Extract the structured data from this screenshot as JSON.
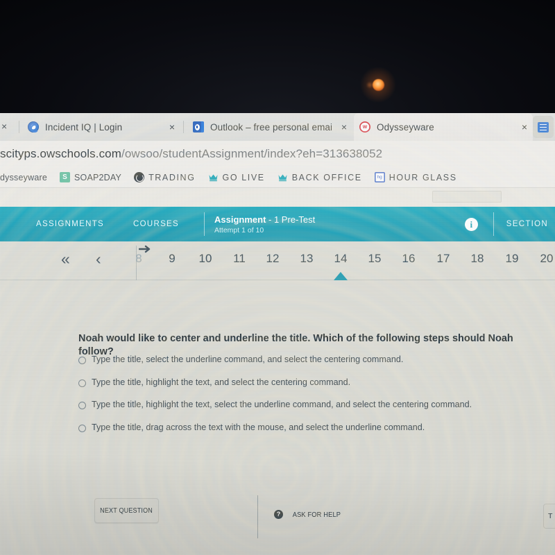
{
  "browser": {
    "tabs": [
      {
        "title": "Incident IQ | Login",
        "favicon": "incident-iq-icon",
        "close_label": "×",
        "active": false
      },
      {
        "title": "Outlook – free personal email",
        "favicon": "outlook-icon",
        "close_label": "×",
        "active": false
      },
      {
        "title": "Odysseyware",
        "favicon": "odysseyware-icon",
        "close_label": "×",
        "active": true
      }
    ],
    "leading_close_label": "×",
    "tab_list_icon": "tab-list-icon",
    "url": {
      "host": "scityps.owschools.com",
      "path": "/owsoo/studentAssignment/index?eh=313638052"
    },
    "bookmarks": [
      {
        "label": "dysseyware",
        "icon": ""
      },
      {
        "label": "SOAP2DAY",
        "icon": "soap2day-icon"
      },
      {
        "label": "TRADING",
        "icon": "globe-icon"
      },
      {
        "label": "GO LIVE",
        "icon": "crown-icon"
      },
      {
        "label": "BACK OFFICE",
        "icon": "crown-icon"
      },
      {
        "label": "HOUR GLASS",
        "icon": "hourglass-icon"
      }
    ]
  },
  "appbar": {
    "assignments_label": "ASSIGNMENTS",
    "courses_label": "COURSES",
    "assignment_name": "Assignment",
    "assignment_suffix": " - 1  Pre-Test",
    "attempt_text": "Attempt 1 of 10",
    "info_icon": "info-icon",
    "section_label": "SECTION",
    "accent_color": "#0a93ab"
  },
  "question_nav": {
    "first_label": "«",
    "prev_label": "‹",
    "numbers": [
      "8",
      "9",
      "10",
      "11",
      "12",
      "13",
      "14",
      "15",
      "16",
      "17",
      "18",
      "19",
      "20"
    ],
    "current": "14",
    "dimmed": "8",
    "cursor_icon": "arrow-cursor-icon",
    "marker_color": "#0b8ea6"
  },
  "question": {
    "prompt": "Noah would like to center and underline the title. Which of the following steps should Noah follow?",
    "options": [
      "Type the title, select the underline command, and select the centering command.",
      "Type the title, highlight the text, and select the centering command.",
      "Type the title, highlight the text, select the underline command, and select the centering command.",
      "Type the title, drag across the text with the mouse, and select the underline command."
    ],
    "selected_index": null
  },
  "footer": {
    "next_label": "NEXT QUESTION",
    "help_label": "ASK FOR HELP",
    "help_icon": "question-mark-icon",
    "edge_button_label": "T"
  }
}
